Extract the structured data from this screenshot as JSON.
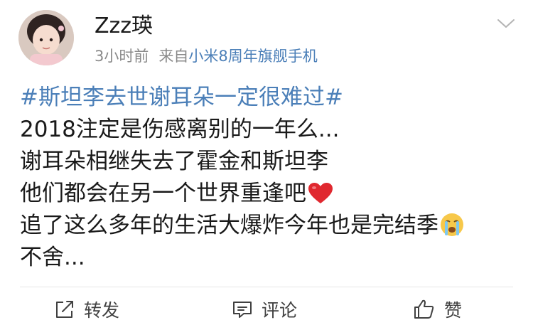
{
  "author": {
    "name": "Zzz瑛",
    "time": "3小时前",
    "source_prefix": "来自",
    "device": "小米8周年旗舰手机"
  },
  "post": {
    "topic": "#斯坦李去世谢耳朵一定很难过#",
    "lines": [
      "2018注定是伤感离别的一年么...",
      "谢耳朵相继失去了霍金和斯坦李",
      "他们都会在另一个世界重逢吧",
      "追了这么多年的生活大爆炸今年也是完结季",
      "不舍..."
    ],
    "emojis": [
      "red-heart-icon",
      "crying-face-icon"
    ]
  },
  "actions": {
    "repost": "转发",
    "comment": "评论",
    "like": "赞"
  },
  "colors": {
    "link": "#4b7fb8",
    "meta": "#8a8a8a",
    "heart": "#e0282f"
  }
}
